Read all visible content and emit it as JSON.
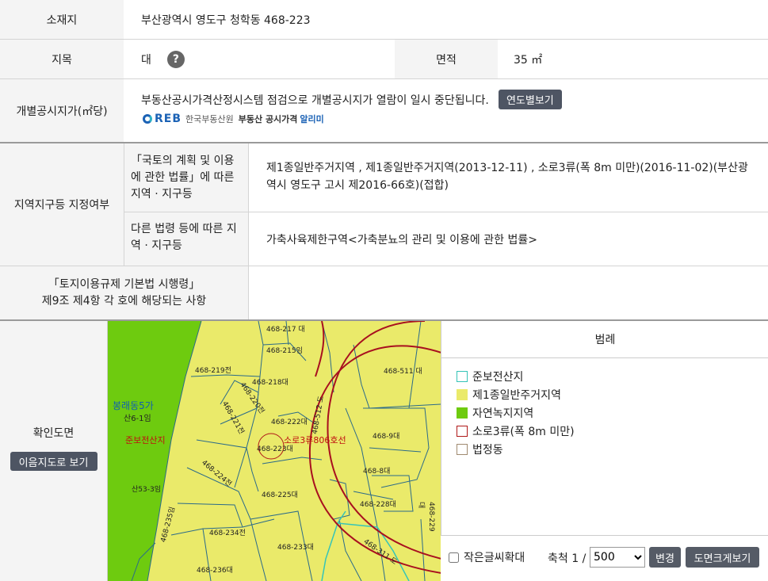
{
  "location": {
    "label": "소재지",
    "value": "부산광역시 영도구 청학동 468-223"
  },
  "land_category": {
    "label": "지목",
    "value": "대",
    "help_icon": "?"
  },
  "area": {
    "label": "면적",
    "value": "35 ㎡"
  },
  "price": {
    "label": "개별공시지가(㎡당)",
    "notice": "부동산공시가격산정시스템 점검으로 개별공시지가 열람이 일시 중단됩니다.",
    "button": "연도별보기",
    "logo_reb": "REB",
    "logo_org": "한국부동산원",
    "logo_service": "부동산 공시가격",
    "logo_service_accent": "알리미"
  },
  "zoning": {
    "label": "지역지구등 지정여부",
    "row1_label": "「국토의 계획 및 이용에 관한 법률」에 따른 지역 · 지구등",
    "row1_value": "제1종일반주거지역 , 제1종일반주거지역(2013-12-11) , 소로3류(폭 8m 미만)(2016-11-02)(부산광역시 영도구 고시 제2016-66호)(접합)",
    "row2_label": "다른 법령 등에 따른 지역 · 지구등",
    "row2_value": "가축사육제한구역<가축분뇨의 관리 및 이용에 관한 법률>"
  },
  "article": {
    "label_line1": "「토지이용규제 기본법 시행령」",
    "label_line2": "제9조 제4항 각 호에 해당되는 사항",
    "value": ""
  },
  "confirm_map": {
    "label": "확인도면",
    "button": "이음지도로 보기"
  },
  "map_labels": {
    "area_name": "봉래동5가",
    "sub_label": "산6-1임",
    "conservation": "준보전산지",
    "road": "소로3류806호선",
    "target": "468-223대",
    "parcels": [
      "468-217 대",
      "468-215임",
      "468-219전",
      "468-218대",
      "468-220전",
      "468-221전",
      "468-222대",
      "468-511 대",
      "468-512 도",
      "468-9대",
      "468-8대",
      "468-224전",
      "468-225대",
      "468-228대",
      "468-229대",
      "468-234전",
      "468-233대",
      "468-311 도",
      "468-235임",
      "산53-3임",
      "468-236대"
    ]
  },
  "legend": {
    "title": "범례",
    "items": [
      {
        "label": "준보전산지",
        "fill": "#ffffff",
        "border": "#35c4b8"
      },
      {
        "label": "제1종일반주거지역",
        "fill": "#eaea6a",
        "border": "#eaea6a"
      },
      {
        "label": "자연녹지지역",
        "fill": "#6ecb0f",
        "border": "#6ecb0f"
      },
      {
        "label": "소로3류(폭 8m 미만)",
        "fill": "#ffffff",
        "border": "#b01818"
      },
      {
        "label": "법정동",
        "fill": "#ffffff",
        "border": "#a08a70"
      }
    ]
  },
  "controls": {
    "enlarge_text_label": "작은글씨확대",
    "scale_label": "축척 1 /",
    "scale_value": "500",
    "scale_options": [
      "500",
      "1000",
      "1200",
      "2400",
      "3000"
    ],
    "apply_button": "변경",
    "large_view_button": "도면크게보기"
  },
  "colors": {
    "header_bg": "#f4f4f4",
    "button_dark": "#4e5563",
    "residential": "#eaea6a",
    "green": "#6ecb0f",
    "road_red": "#a8101f",
    "parcel_line": "#2a6a8a"
  }
}
